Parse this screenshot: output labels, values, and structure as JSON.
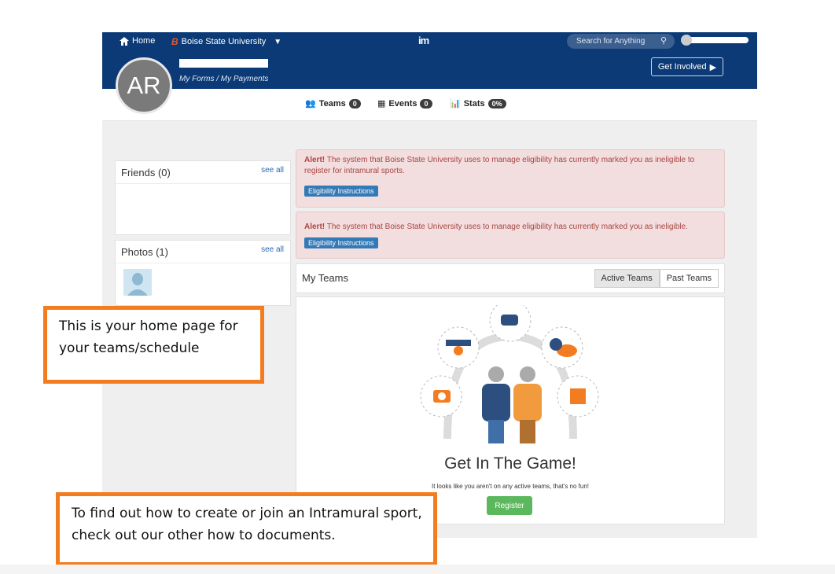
{
  "topnav": {
    "home_label": "Home",
    "university_label": "Boise State University",
    "brand_logo": "im",
    "search_placeholder": "Search for Anything"
  },
  "profile": {
    "avatar_initials": "AR",
    "my_forms_label": "My Forms /",
    "my_payments_label": "My Payments",
    "get_involved_label": "Get Involved"
  },
  "subnav": {
    "items": [
      {
        "label": "Teams",
        "badge": "0",
        "icon": "users-icon"
      },
      {
        "label": "Events",
        "badge": "0",
        "icon": "calendar-icon"
      },
      {
        "label": "Stats",
        "badge": "0%",
        "icon": "bar-chart-icon"
      }
    ]
  },
  "sidebar": {
    "friends": {
      "title": "Friends (0)",
      "see_all": "see all"
    },
    "photos": {
      "title": "Photos (1)",
      "see_all": "see all"
    }
  },
  "alerts": [
    {
      "prefix": "Alert!",
      "text": "The system that Boise State University uses to manage eligibility has currently marked you as ineligible to register for intramural sports.",
      "button": "Eligibility Instructions"
    },
    {
      "prefix": "Alert!",
      "text": "The system that Boise State University uses to manage eligibility has currently marked you as ineligible.",
      "button": "Eligibility Instructions"
    }
  ],
  "my_teams": {
    "title": "My Teams",
    "tabs": [
      "Active Teams",
      "Past Teams"
    ],
    "empty_title": "Get In The Game!",
    "empty_text": "It looks like you aren't on any active teams, that's no fun!",
    "register_label": "Register"
  },
  "callouts": {
    "home_note": "This is your home page for your teams/schedule",
    "howto_note": "To find out how to create or join an Intramural sport, check out our other how to documents."
  },
  "colors": {
    "navy": "#0b3a76",
    "callout_orange": "#f47c20",
    "alert_bg": "#f2dede",
    "register_green": "#5cb85c"
  }
}
